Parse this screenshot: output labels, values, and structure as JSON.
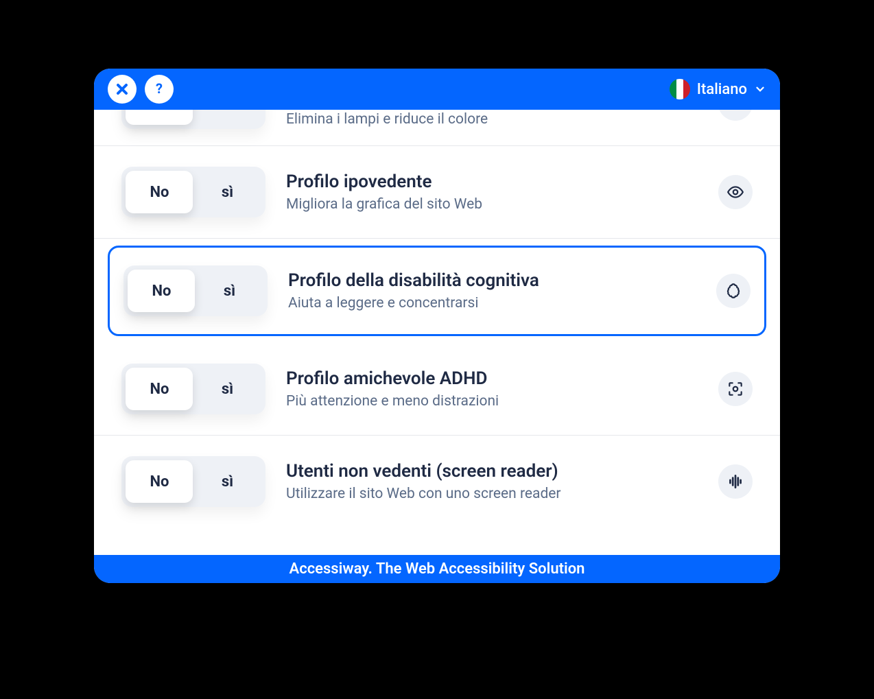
{
  "header": {
    "language_label": "Italiano"
  },
  "toggle": {
    "no": "No",
    "yes": "sì"
  },
  "profiles": [
    {
      "title": "",
      "desc": "Elimina i lampi e riduce il colore",
      "icon": "seizure-icon",
      "partial": true
    },
    {
      "title": "Profilo ipovedente",
      "desc": "Migliora la grafica del sito Web",
      "icon": "eye-icon"
    },
    {
      "title": "Profilo della disabilità cognitiva",
      "desc": "Aiuta a leggere e concentrarsi",
      "icon": "brain-icon",
      "selected": true
    },
    {
      "title": "Profilo amichevole ADHD",
      "desc": "Più attenzione e meno distrazioni",
      "icon": "focus-icon"
    },
    {
      "title": "Utenti non vedenti (screen reader)",
      "desc": "Utilizzare il sito Web con uno screen reader",
      "icon": "audio-icon"
    }
  ],
  "footer": {
    "text": "Accessiway. The Web Accessibility Solution"
  }
}
